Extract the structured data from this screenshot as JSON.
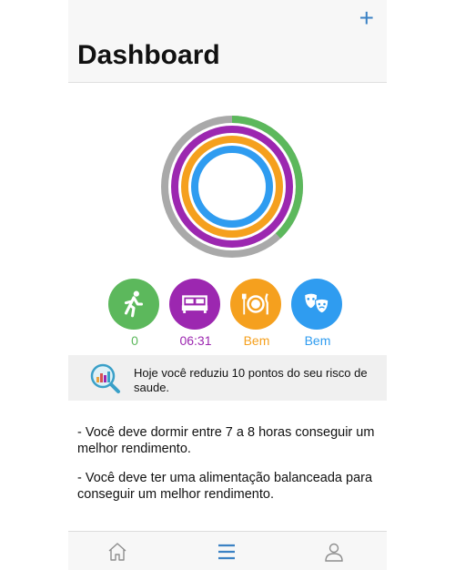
{
  "header": {
    "title": "Dashboard",
    "add_label": "+"
  },
  "rings": [
    {
      "name": "activity",
      "color_track": "#a9a9a9",
      "color": "#5cb85c",
      "progress": 0.38
    },
    {
      "name": "sleep",
      "color_track": "#9c27b0",
      "color": "#9c27b0",
      "progress": 1.0
    },
    {
      "name": "food",
      "color_track": "#f5a01e",
      "color": "#f5a01e",
      "progress": 1.0
    },
    {
      "name": "mood",
      "color_track": "#2f9cf0",
      "color": "#2f9cf0",
      "progress": 1.0
    }
  ],
  "stats": [
    {
      "icon": "running-person-icon",
      "color": "#5cb85c",
      "value": "0"
    },
    {
      "icon": "bed-icon",
      "color": "#9c27b0",
      "value": "06:31"
    },
    {
      "icon": "plate-cutlery-icon",
      "color": "#f5a01e",
      "value": "Bem"
    },
    {
      "icon": "theater-masks-icon",
      "color": "#2f9cf0",
      "value": "Bem"
    }
  ],
  "notice": {
    "icon": "health-report-icon",
    "text": "Hoje você reduziu 10 pontos do seu risco de saude."
  },
  "tips": [
    "- Você deve dormir entre 7 a 8 horas conseguir um melhor rendimento.",
    "- Você deve ter uma alimentação balanceada para conseguir um melhor rendimento."
  ],
  "tabbar": {
    "items": [
      {
        "icon": "home-icon",
        "active": false
      },
      {
        "icon": "menu-list-icon",
        "active": true
      },
      {
        "icon": "profile-icon",
        "active": false
      }
    ],
    "active_color": "#3b82c4",
    "inactive_color": "#8e8e8e"
  }
}
